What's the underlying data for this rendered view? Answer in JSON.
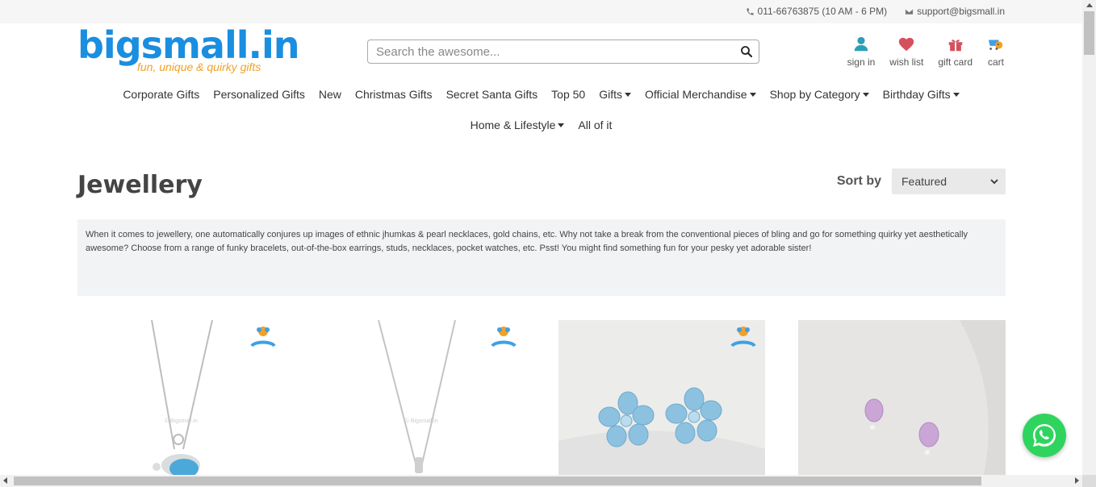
{
  "topbar": {
    "phone": "011-66763875 (10 AM - 6 PM)",
    "email": "support@bigsmall.in"
  },
  "logo": {
    "name": "bigsmall.in",
    "tagline": "fun, unique & quirky gifts"
  },
  "search": {
    "placeholder": "Search the awesome..."
  },
  "header_links": {
    "sign_in": "sign in",
    "wish_list": "wish list",
    "gift_card": "gift card",
    "cart": "cart"
  },
  "nav": {
    "row1": [
      {
        "label": "Corporate Gifts",
        "dropdown": false
      },
      {
        "label": "Personalized Gifts",
        "dropdown": false
      },
      {
        "label": "New",
        "dropdown": false
      },
      {
        "label": "Christmas Gifts",
        "dropdown": false
      },
      {
        "label": "Secret Santa Gifts",
        "dropdown": false
      },
      {
        "label": "Top 50",
        "dropdown": false
      },
      {
        "label": "Gifts",
        "dropdown": true
      },
      {
        "label": "Official Merchandise",
        "dropdown": true
      },
      {
        "label": "Shop by Category",
        "dropdown": true
      },
      {
        "label": "Birthday Gifts",
        "dropdown": true
      }
    ],
    "row2": [
      {
        "label": "Home & Lifestyle",
        "dropdown": true
      },
      {
        "label": "All of it",
        "dropdown": false
      }
    ]
  },
  "page": {
    "title": "Jewellery",
    "sort_label": "Sort by",
    "sort_value": "Featured",
    "description": "When it comes to jewellery, one automatically conjures up images of ethnic jhumkas & pearl necklaces, gold chains, etc. Why not take a break from the conventional pieces of bling and go for something quirky yet aesthetically awesome? Choose from a range of funky bracelets, out-of-the-box earrings, studs, necklaces, pocket watches, etc. Psst! You might find something fun for your pesky yet adorable sister!"
  },
  "products": [
    {
      "image": "blue-topaz-elephant-pendant-necklace",
      "watermark": "© Bigsmall.in",
      "badge": true
    },
    {
      "image": "silver-drop-pendant-necklace",
      "watermark": "© Bigsmall.in",
      "badge": true
    },
    {
      "image": "blue-flower-stud-earrings",
      "badge": true
    },
    {
      "image": "amethyst-stud-earrings",
      "badge": false
    }
  ],
  "colors": {
    "brand_blue": "#1a8ee0",
    "brand_orange": "#f2a026",
    "whatsapp_green": "#2fd45e",
    "wishlist_red": "#d4505c",
    "signin_teal": "#2a9fb5"
  }
}
